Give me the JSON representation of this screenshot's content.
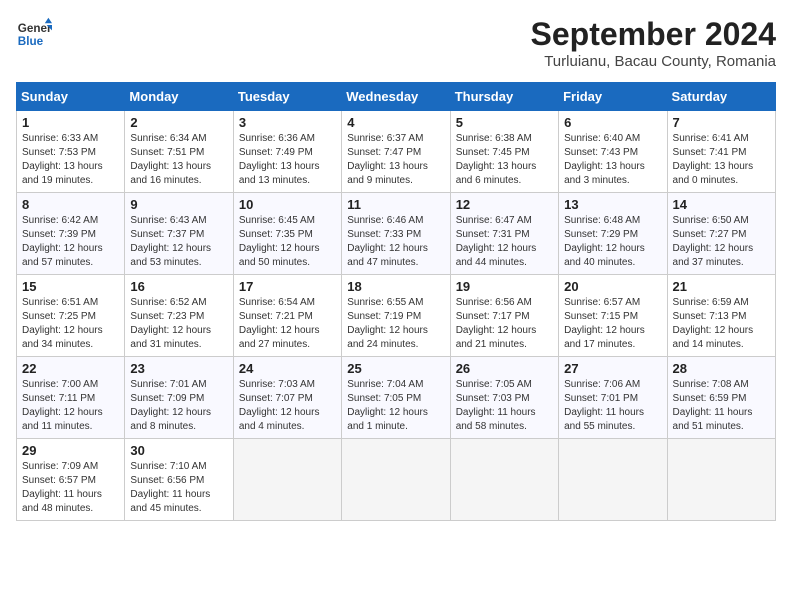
{
  "header": {
    "logo_line1": "General",
    "logo_line2": "Blue",
    "month": "September 2024",
    "location": "Turluianu, Bacau County, Romania"
  },
  "days_of_week": [
    "Sunday",
    "Monday",
    "Tuesday",
    "Wednesday",
    "Thursday",
    "Friday",
    "Saturday"
  ],
  "weeks": [
    [
      {
        "day": 1,
        "lines": [
          "Sunrise: 6:33 AM",
          "Sunset: 7:53 PM",
          "Daylight: 13 hours",
          "and 19 minutes."
        ]
      },
      {
        "day": 2,
        "lines": [
          "Sunrise: 6:34 AM",
          "Sunset: 7:51 PM",
          "Daylight: 13 hours",
          "and 16 minutes."
        ]
      },
      {
        "day": 3,
        "lines": [
          "Sunrise: 6:36 AM",
          "Sunset: 7:49 PM",
          "Daylight: 13 hours",
          "and 13 minutes."
        ]
      },
      {
        "day": 4,
        "lines": [
          "Sunrise: 6:37 AM",
          "Sunset: 7:47 PM",
          "Daylight: 13 hours",
          "and 9 minutes."
        ]
      },
      {
        "day": 5,
        "lines": [
          "Sunrise: 6:38 AM",
          "Sunset: 7:45 PM",
          "Daylight: 13 hours",
          "and 6 minutes."
        ]
      },
      {
        "day": 6,
        "lines": [
          "Sunrise: 6:40 AM",
          "Sunset: 7:43 PM",
          "Daylight: 13 hours",
          "and 3 minutes."
        ]
      },
      {
        "day": 7,
        "lines": [
          "Sunrise: 6:41 AM",
          "Sunset: 7:41 PM",
          "Daylight: 13 hours",
          "and 0 minutes."
        ]
      }
    ],
    [
      {
        "day": 8,
        "lines": [
          "Sunrise: 6:42 AM",
          "Sunset: 7:39 PM",
          "Daylight: 12 hours",
          "and 57 minutes."
        ]
      },
      {
        "day": 9,
        "lines": [
          "Sunrise: 6:43 AM",
          "Sunset: 7:37 PM",
          "Daylight: 12 hours",
          "and 53 minutes."
        ]
      },
      {
        "day": 10,
        "lines": [
          "Sunrise: 6:45 AM",
          "Sunset: 7:35 PM",
          "Daylight: 12 hours",
          "and 50 minutes."
        ]
      },
      {
        "day": 11,
        "lines": [
          "Sunrise: 6:46 AM",
          "Sunset: 7:33 PM",
          "Daylight: 12 hours",
          "and 47 minutes."
        ]
      },
      {
        "day": 12,
        "lines": [
          "Sunrise: 6:47 AM",
          "Sunset: 7:31 PM",
          "Daylight: 12 hours",
          "and 44 minutes."
        ]
      },
      {
        "day": 13,
        "lines": [
          "Sunrise: 6:48 AM",
          "Sunset: 7:29 PM",
          "Daylight: 12 hours",
          "and 40 minutes."
        ]
      },
      {
        "day": 14,
        "lines": [
          "Sunrise: 6:50 AM",
          "Sunset: 7:27 PM",
          "Daylight: 12 hours",
          "and 37 minutes."
        ]
      }
    ],
    [
      {
        "day": 15,
        "lines": [
          "Sunrise: 6:51 AM",
          "Sunset: 7:25 PM",
          "Daylight: 12 hours",
          "and 34 minutes."
        ]
      },
      {
        "day": 16,
        "lines": [
          "Sunrise: 6:52 AM",
          "Sunset: 7:23 PM",
          "Daylight: 12 hours",
          "and 31 minutes."
        ]
      },
      {
        "day": 17,
        "lines": [
          "Sunrise: 6:54 AM",
          "Sunset: 7:21 PM",
          "Daylight: 12 hours",
          "and 27 minutes."
        ]
      },
      {
        "day": 18,
        "lines": [
          "Sunrise: 6:55 AM",
          "Sunset: 7:19 PM",
          "Daylight: 12 hours",
          "and 24 minutes."
        ]
      },
      {
        "day": 19,
        "lines": [
          "Sunrise: 6:56 AM",
          "Sunset: 7:17 PM",
          "Daylight: 12 hours",
          "and 21 minutes."
        ]
      },
      {
        "day": 20,
        "lines": [
          "Sunrise: 6:57 AM",
          "Sunset: 7:15 PM",
          "Daylight: 12 hours",
          "and 17 minutes."
        ]
      },
      {
        "day": 21,
        "lines": [
          "Sunrise: 6:59 AM",
          "Sunset: 7:13 PM",
          "Daylight: 12 hours",
          "and 14 minutes."
        ]
      }
    ],
    [
      {
        "day": 22,
        "lines": [
          "Sunrise: 7:00 AM",
          "Sunset: 7:11 PM",
          "Daylight: 12 hours",
          "and 11 minutes."
        ]
      },
      {
        "day": 23,
        "lines": [
          "Sunrise: 7:01 AM",
          "Sunset: 7:09 PM",
          "Daylight: 12 hours",
          "and 8 minutes."
        ]
      },
      {
        "day": 24,
        "lines": [
          "Sunrise: 7:03 AM",
          "Sunset: 7:07 PM",
          "Daylight: 12 hours",
          "and 4 minutes."
        ]
      },
      {
        "day": 25,
        "lines": [
          "Sunrise: 7:04 AM",
          "Sunset: 7:05 PM",
          "Daylight: 12 hours",
          "and 1 minute."
        ]
      },
      {
        "day": 26,
        "lines": [
          "Sunrise: 7:05 AM",
          "Sunset: 7:03 PM",
          "Daylight: 11 hours",
          "and 58 minutes."
        ]
      },
      {
        "day": 27,
        "lines": [
          "Sunrise: 7:06 AM",
          "Sunset: 7:01 PM",
          "Daylight: 11 hours",
          "and 55 minutes."
        ]
      },
      {
        "day": 28,
        "lines": [
          "Sunrise: 7:08 AM",
          "Sunset: 6:59 PM",
          "Daylight: 11 hours",
          "and 51 minutes."
        ]
      }
    ],
    [
      {
        "day": 29,
        "lines": [
          "Sunrise: 7:09 AM",
          "Sunset: 6:57 PM",
          "Daylight: 11 hours",
          "and 48 minutes."
        ]
      },
      {
        "day": 30,
        "lines": [
          "Sunrise: 7:10 AM",
          "Sunset: 6:56 PM",
          "Daylight: 11 hours",
          "and 45 minutes."
        ]
      },
      null,
      null,
      null,
      null,
      null
    ]
  ]
}
